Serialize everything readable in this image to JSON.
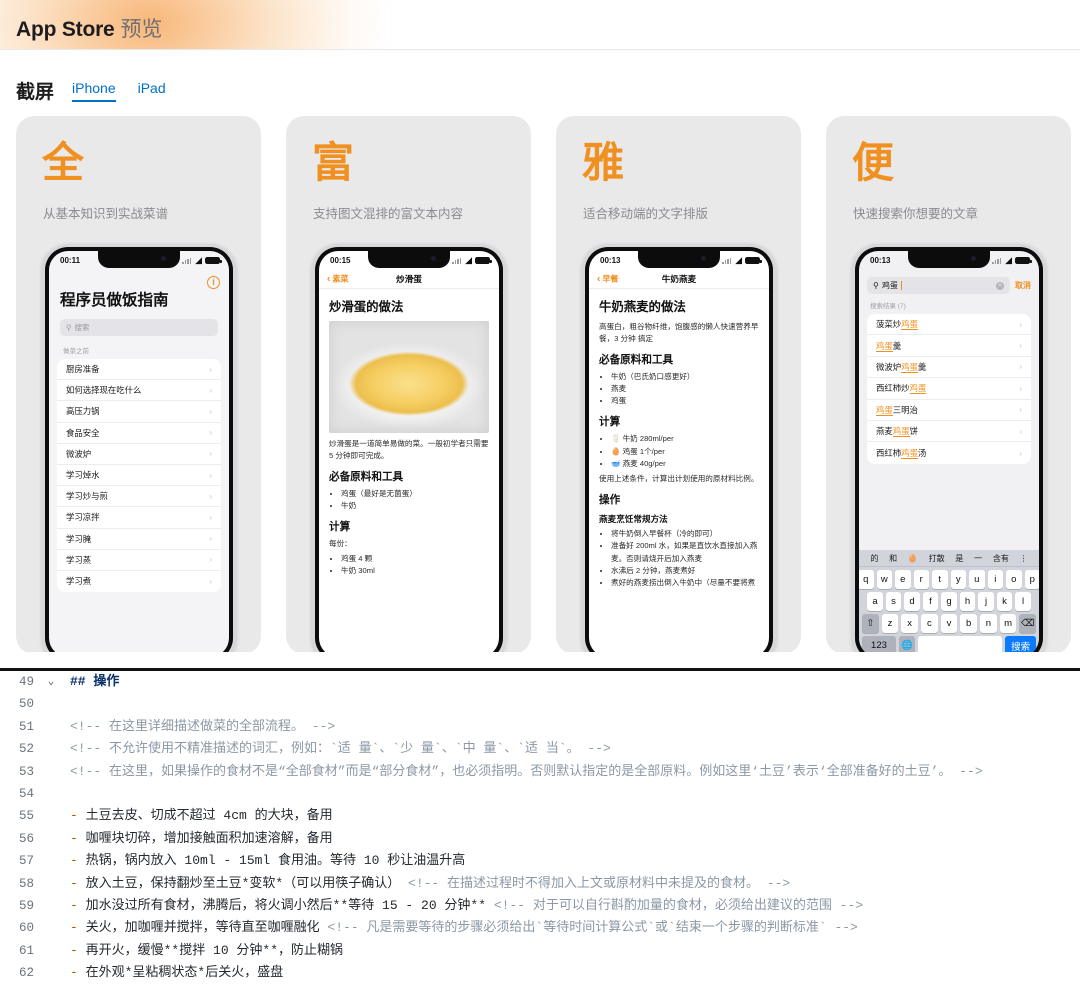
{
  "topbar": {
    "brand": "App Store",
    "suffix": "预览",
    "accent": "#F09020"
  },
  "section": {
    "title": "截屏",
    "tabs": [
      {
        "label": "iPhone",
        "active": true
      },
      {
        "label": "iPad",
        "active": false
      }
    ]
  },
  "shots": [
    {
      "hanzi": "全",
      "subtitle": "从基本知识到实战菜谱",
      "status": {
        "time": "00:11"
      },
      "screen": {
        "kind": "index",
        "info_badge": "i",
        "title": "程序员做饭指南",
        "search_placeholder": "搜索",
        "group_label": "做菜之前",
        "rows": [
          "厨房准备",
          "如何选择现在吃什么",
          "高压力锅",
          "食品安全",
          "微波炉",
          "学习焯水",
          "学习炒与煎",
          "学习凉拌",
          "学习腌",
          "学习蒸",
          "学习煮"
        ]
      }
    },
    {
      "hanzi": "富",
      "subtitle": "支持图文混排的富文本内容",
      "status": {
        "time": "00:15"
      },
      "screen": {
        "kind": "article",
        "nav_back": "素菜",
        "nav_title": "炒滑蛋",
        "h1": "炒滑蛋的做法",
        "caption": "炒滑蛋是一道简单易做的菜。一般初学者只需要 5 分钟即可完成。",
        "h2_a": "必备原料和工具",
        "list_a": [
          "鸡蛋（最好是无菌蛋）",
          "牛奶"
        ],
        "h2_b": "计算",
        "per_label": "每份：",
        "list_b": [
          "鸡蛋 4 颗",
          "牛奶 30ml"
        ]
      }
    },
    {
      "hanzi": "雅",
      "subtitle": "适合移动端的文字排版",
      "status": {
        "time": "00:13"
      },
      "screen": {
        "kind": "article2",
        "nav_back": "早餐",
        "nav_title": "牛奶燕麦",
        "h1": "牛奶燕麦的做法",
        "intro": "高蛋白，粗谷物纤维，饱腹感的懒人快速营养早餐，3 分钟 搞定",
        "h2_a": "必备原料和工具",
        "list_a": [
          "牛奶（巴氏奶口感更好）",
          "燕麦",
          "鸡蛋"
        ],
        "h2_b": "计算",
        "list_b": [
          "🥛 牛奶 280ml/per",
          "🥚 鸡蛋 1个/per",
          "🥣 燕麦 40g/per"
        ],
        "note": "使用上述条件，计算出计划使用的原材料比例。",
        "h2_c": "操作",
        "h3_c": "燕麦烹饪常规方法",
        "list_c": [
          "将牛奶倒入早餐杯（冷的即可）",
          "准备好 200ml 水，如果是直饮水直接加入燕麦。否则请烧开后加入燕麦",
          "水沸后 2 分钟，燕麦煮好",
          "煮好的燕麦捞出倒入牛奶中（尽量不要将煮"
        ]
      }
    },
    {
      "hanzi": "便",
      "subtitle": "快速搜索你想要的文章",
      "status": {
        "time": "00:13"
      },
      "screen": {
        "kind": "search",
        "query": "鸡蛋",
        "cancel_label": "取消",
        "result_count_label": "搜索结果 (7)",
        "results": [
          {
            "pre": "菠菜炒",
            "hit": "鸡蛋",
            "post": ""
          },
          {
            "pre": "",
            "hit": "鸡蛋",
            "post": "羹"
          },
          {
            "pre": "微波炉",
            "hit": "鸡蛋",
            "post": "羹"
          },
          {
            "pre": "西红柿炒",
            "hit": "鸡蛋",
            "post": ""
          },
          {
            "pre": "",
            "hit": "鸡蛋",
            "post": "三明治"
          },
          {
            "pre": "燕麦",
            "hit": "鸡蛋",
            "post": "饼"
          },
          {
            "pre": "西红柿",
            "hit": "鸡蛋",
            "post": "汤"
          }
        ],
        "keyboard": {
          "predictions": [
            "的",
            "和",
            "🥚",
            "打散",
            "是",
            "一",
            "含有",
            "⋮"
          ],
          "row1": [
            "q",
            "w",
            "e",
            "r",
            "t",
            "y",
            "u",
            "i",
            "o",
            "p"
          ],
          "row2": [
            "a",
            "s",
            "d",
            "f",
            "g",
            "h",
            "j",
            "k",
            "l"
          ],
          "row3": [
            "⇧",
            "z",
            "x",
            "c",
            "v",
            "b",
            "n",
            "m",
            "⌫"
          ],
          "row4": [
            "123",
            "🌐",
            "",
            "搜索"
          ]
        }
      }
    }
  ],
  "editor": {
    "lines": [
      {
        "num": "49",
        "fold": "⌄",
        "segments": [
          {
            "t": "## 操作",
            "c": "c-head"
          }
        ]
      },
      {
        "num": "50",
        "fold": "",
        "segments": []
      },
      {
        "num": "51",
        "fold": "",
        "segments": [
          {
            "t": "    <!-- 在这里详细描述做菜的全部流程。 -->",
            "c": "c-comment"
          }
        ]
      },
      {
        "num": "52",
        "fold": "",
        "segments": [
          {
            "t": "    <!-- 不允许使用不精准描述的词汇，例如：`适 量`、`少 量`、`中 量`、`适 当`。 -->",
            "c": "c-comment"
          }
        ]
      },
      {
        "num": "53",
        "fold": "",
        "segments": [
          {
            "t": "    <!-- 在这里，如果操作的食材不是“全部食材”而是“部分食材”，也必须指明。否则默认指定的是全部原料。例如这里‘土豆’表示‘全部准备好的土豆’。 -->",
            "c": "c-comment"
          }
        ]
      },
      {
        "num": "54",
        "fold": "",
        "segments": []
      },
      {
        "num": "55",
        "fold": "",
        "segments": [
          {
            "t": "    - ",
            "c": "c-bullet"
          },
          {
            "t": "土豆去皮、切成不超过 4cm 的大块，备用",
            "c": "c-body"
          }
        ]
      },
      {
        "num": "56",
        "fold": "",
        "segments": [
          {
            "t": "    - ",
            "c": "c-bullet"
          },
          {
            "t": "咖喱块切碎，增加接触面积加速溶解，备用",
            "c": "c-body"
          }
        ]
      },
      {
        "num": "57",
        "fold": "",
        "segments": [
          {
            "t": "    - ",
            "c": "c-bullet"
          },
          {
            "t": "热锅，锅内放入 10ml - 15ml 食用油。等待 10 秒让油温升高",
            "c": "c-body"
          }
        ]
      },
      {
        "num": "58",
        "fold": "",
        "segments": [
          {
            "t": "    - ",
            "c": "c-bullet"
          },
          {
            "t": "放入土豆，保持翻炒至土豆*变软*（可以用筷子确认）",
            "c": "c-body"
          },
          {
            "t": " <!-- 在描述过程时不得加入上文或原材料中未提及的食材。 -->",
            "c": "c-comment"
          }
        ]
      },
      {
        "num": "59",
        "fold": "",
        "segments": [
          {
            "t": "    - ",
            "c": "c-bullet"
          },
          {
            "t": "加水没过所有食材，沸腾后，将火调小然后**等待 15 - 20 分钟**",
            "c": "c-body"
          },
          {
            "t": " <!-- 对于可以自行斟酌加量的食材，必须给出建议的范围 -->",
            "c": "c-comment"
          }
        ]
      },
      {
        "num": "60",
        "fold": "",
        "segments": [
          {
            "t": "    - ",
            "c": "c-bullet"
          },
          {
            "t": "关火，加咖喱并搅拌，等待直至咖喱融化",
            "c": "c-body"
          },
          {
            "t": " <!-- 凡是需要等待的步骤必须给出`等待时间计算公式`或`结束一个步骤的判断标准` -->",
            "c": "c-comment"
          }
        ]
      },
      {
        "num": "61",
        "fold": "",
        "segments": [
          {
            "t": "    - ",
            "c": "c-bullet"
          },
          {
            "t": "再开火，缓慢**搅拌 10 分钟**，防止糊锅",
            "c": "c-body"
          }
        ]
      },
      {
        "num": "62",
        "fold": "",
        "segments": [
          {
            "t": "    - ",
            "c": "c-bullet"
          },
          {
            "t": "在外观*呈粘稠状态*后关火，盛盘",
            "c": "c-body"
          }
        ]
      }
    ]
  }
}
